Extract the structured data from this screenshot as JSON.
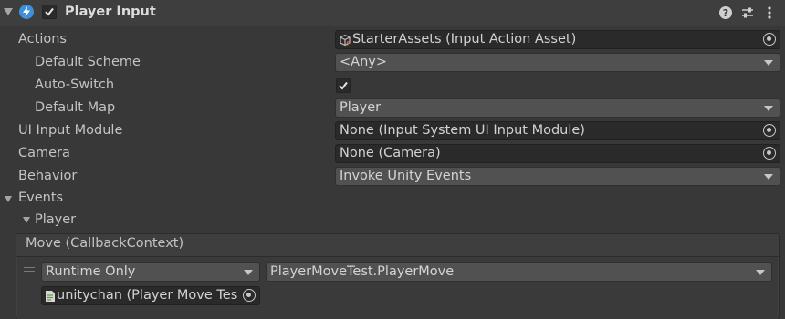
{
  "header": {
    "title": "Player Input",
    "enabled": true,
    "icons": [
      "fold-arrow-icon",
      "player-input-component-icon",
      "help-icon",
      "presets-icon",
      "kebab-menu-icon"
    ]
  },
  "fields": {
    "actions": {
      "label": "Actions",
      "value": "StarterAssets (Input Action Asset)"
    },
    "default_scheme": {
      "label": "Default Scheme",
      "value": "<Any>"
    },
    "auto_switch": {
      "label": "Auto-Switch",
      "checked": true
    },
    "default_map": {
      "label": "Default Map",
      "value": "Player"
    },
    "ui_input_module": {
      "label": "UI Input Module",
      "value": "None (Input System UI Input Module)"
    },
    "camera": {
      "label": "Camera",
      "value": "None (Camera)"
    },
    "behavior": {
      "label": "Behavior",
      "value": "Invoke Unity Events"
    }
  },
  "events": {
    "label": "Events",
    "group": "Player",
    "event_name": "Move (CallbackContext)",
    "listener": {
      "runtime": "Runtime Only",
      "function": "PlayerMoveTest.PlayerMove",
      "target": "unitychan (Player Move Tes"
    }
  },
  "colors": {
    "background": "#383838",
    "field_bg": "#2a2a2a",
    "dropdown_bg": "#515151",
    "component_icon": "#3f8fd8"
  }
}
